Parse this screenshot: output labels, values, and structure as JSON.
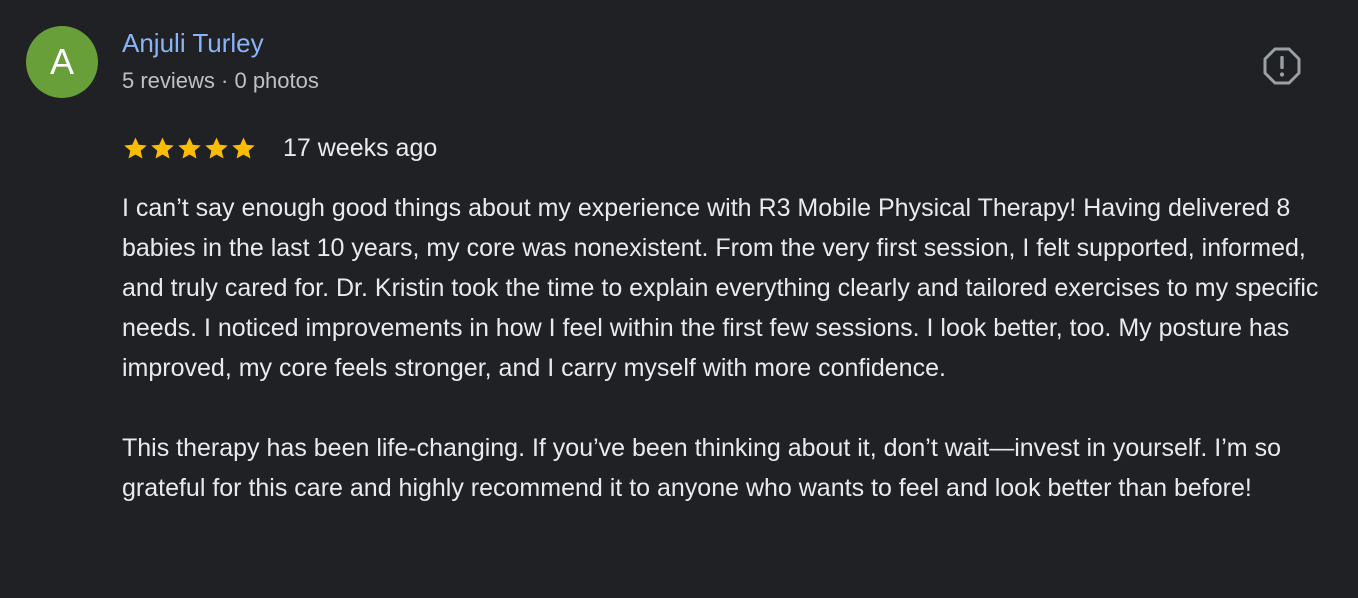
{
  "review": {
    "avatar_letter": "A",
    "avatar_color": "#689f38",
    "author_name": "Anjuli Turley",
    "author_meta": "5 reviews · 0 photos",
    "report_icon": "flag-report-icon",
    "rating": 5,
    "rating_max": 5,
    "star_color": "#fbbc04",
    "date": "17 weeks ago",
    "paragraphs": [
      "I can’t say enough good things about my experience with R3 Mobile Physical Therapy! Having delivered 8 babies in the last 10 years, my core was nonexistent. From the very first session, I felt supported, informed, and truly cared for. Dr. Kristin took the time to explain everything clearly and tailored exercises to my specific needs. I noticed improvements in how I feel within the first few sessions. I look better, too. My posture has improved, my core feels stronger, and I carry myself with more confidence.",
      "This therapy has been life-changing. If you’ve been thinking about it, don’t wait—invest in yourself. I’m so grateful for this care and highly recommend it to anyone who wants to feel and look better than before!"
    ]
  }
}
